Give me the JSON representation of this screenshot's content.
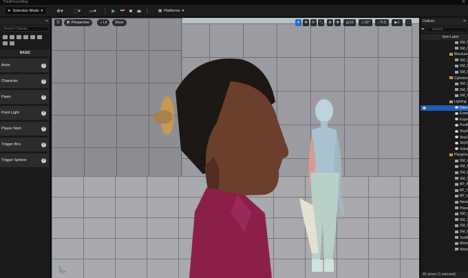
{
  "window": {
    "title": "ThirdPersonMap",
    "close_glyph": "✕"
  },
  "toolbar": {
    "selection_mode": "Selection Mode",
    "platforms": "Platforms",
    "play_color": "#56c35a"
  },
  "place_actors": {
    "tab_close": "✕",
    "search_placeholder": "Search Classes",
    "category": "BASIC",
    "items": [
      {
        "label": "Actor"
      },
      {
        "label": "Character"
      },
      {
        "label": "Pawn"
      },
      {
        "label": "Point Light"
      },
      {
        "label": "Player Start"
      },
      {
        "label": "Trigger Box"
      },
      {
        "label": "Trigger Sphere"
      }
    ]
  },
  "viewport": {
    "perspective": "Perspective",
    "lit": "Lit",
    "show": "Show",
    "grid_snap": "10",
    "rotation_snap": "10°",
    "scale_snap": "0.5",
    "camera_speed": "1",
    "accent": "#1f6fd1"
  },
  "outliner": {
    "title": "Outliner",
    "search_placeholder": "Search",
    "column_label": "Item Label",
    "items": [
      {
        "label": "SM_Ramp",
        "type": "mesh"
      },
      {
        "label": "SM_Cube",
        "type": "mesh"
      },
      {
        "label": "Blockout",
        "type": "folder"
      },
      {
        "label": "SM_Cube",
        "type": "mesh"
      },
      {
        "label": "SM_Cube",
        "type": "mesh"
      },
      {
        "label": "SM_Cube",
        "type": "mesh"
      },
      {
        "label": "Cylinders",
        "type": "folder"
      },
      {
        "label": "SM_Cylinder",
        "type": "mesh"
      },
      {
        "label": "SM_Cylinder",
        "type": "mesh"
      },
      {
        "label": "SM_Cylinder",
        "type": "mesh"
      },
      {
        "label": "Lighting",
        "type": "folder"
      },
      {
        "label": "DirectionalLight",
        "type": "light",
        "selected": true
      },
      {
        "label": "ExponentialHeightFog",
        "type": "light"
      },
      {
        "label": "ExponentialHeightFog",
        "type": "light"
      },
      {
        "label": "PostProcessVolume",
        "type": "light"
      },
      {
        "label": "SkyAtmosphere",
        "type": "light"
      },
      {
        "label": "SkyLight",
        "type": "light"
      },
      {
        "label": "SkySphere",
        "type": "light"
      },
      {
        "label": "VolumetricCloud",
        "type": "light"
      },
      {
        "label": "Playground",
        "type": "folder"
      },
      {
        "label": "SM_Cube",
        "type": "mesh"
      },
      {
        "label": "SM_Cube",
        "type": "mesh"
      },
      {
        "label": "SM_Cube",
        "type": "mesh"
      },
      {
        "label": "SM_Cube",
        "type": "mesh"
      },
      {
        "label": "BP_Actor",
        "type": "mesh"
      },
      {
        "label": "BP_Skin",
        "type": "mesh"
      },
      {
        "label": "BP_VAT",
        "type": "mesh"
      },
      {
        "label": "NewLevel",
        "type": "mesh"
      },
      {
        "label": "PlayerStart",
        "type": "mesh"
      },
      {
        "label": "SM_Cube",
        "type": "mesh"
      },
      {
        "label": "SM_Cube",
        "type": "mesh"
      },
      {
        "label": "SM_Cube",
        "type": "mesh"
      },
      {
        "label": "SM_Ramp",
        "type": "mesh"
      },
      {
        "label": "TextRender",
        "type": "mesh"
      },
      {
        "label": "WorldDataLayers",
        "type": "mesh"
      },
      {
        "label": "WorldPartition",
        "type": "mesh"
      }
    ],
    "footer": "45 actors (1 selected)"
  }
}
